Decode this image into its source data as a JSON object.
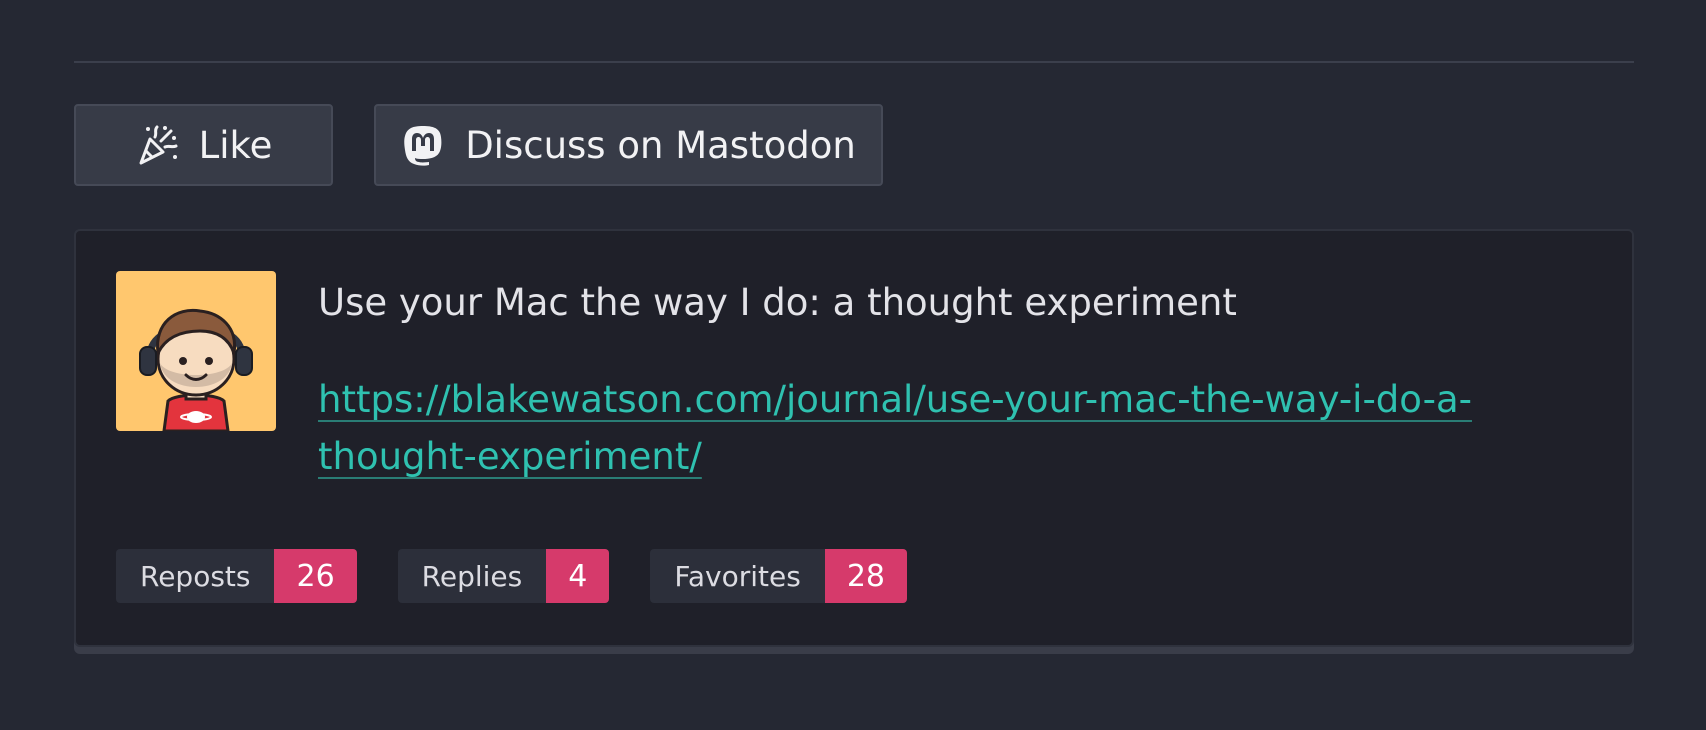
{
  "actions": {
    "like_label": "Like",
    "like_icon": "party-popper-icon",
    "discuss_label": "Discuss on Mastodon",
    "discuss_icon": "mastodon-icon"
  },
  "post": {
    "text": "Use your Mac the way I do: a thought experiment",
    "link": "https://blakewatson.com/journal/use-your-mac-the-way-i-do-a-thought-experiment/",
    "avatar_icon": "avatar-headphones-illustration"
  },
  "stats": [
    {
      "label": "Reposts",
      "count": "26"
    },
    {
      "label": "Replies",
      "count": "4"
    },
    {
      "label": "Favorites",
      "count": "28"
    }
  ],
  "colors": {
    "background": "#252833",
    "card": "#1f2029",
    "button": "#373b47",
    "link": "#2fc1b0",
    "badge": "#d63a6b",
    "avatar_bg": "#ffc76e"
  }
}
